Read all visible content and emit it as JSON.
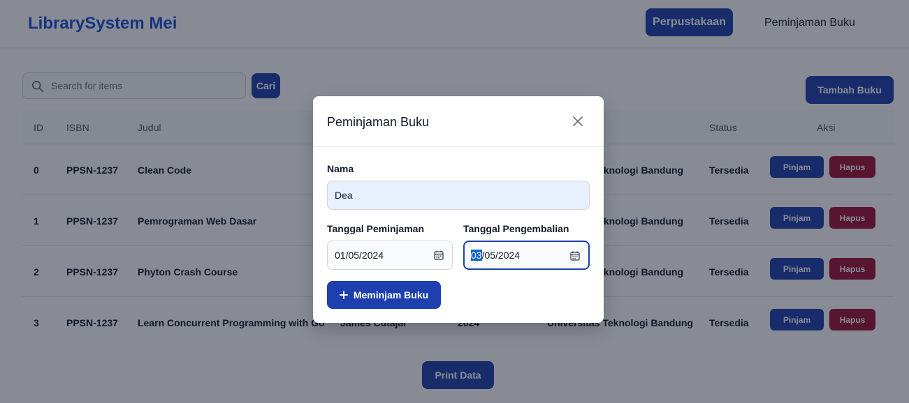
{
  "header": {
    "brand": "LibrarySystem Mei",
    "nav_active": "Perpustakaan",
    "nav_link": "Peminjaman Buku"
  },
  "search": {
    "placeholder": "Search for items",
    "button": "Cari"
  },
  "add_button": "Tambah Buku",
  "table": {
    "columns": [
      "ID",
      "ISBN",
      "Judul",
      "Status",
      "Aksi"
    ],
    "rows": [
      {
        "id": "0",
        "isbn": "PPSN-1237",
        "judul": "Clean Code",
        "penerbit": "eknologi Bandung",
        "status": "Tersedia"
      },
      {
        "id": "1",
        "isbn": "PPSN-1237",
        "judul": "Pemrograman Web Dasar",
        "penerbit": "eknologi Bandung",
        "status": "Tersedia"
      },
      {
        "id": "2",
        "isbn": "PPSN-1237",
        "judul": "Phyton Crash Course",
        "penerbit": "eknologi Bandung",
        "status": "Tersedia"
      },
      {
        "id": "3",
        "isbn": "PPSN-1237",
        "judul": "Learn Concurrent Programming with Go",
        "penulis": "James Cutajar",
        "tahun": "2024",
        "penerbit": "Universitas Teknologi Bandung",
        "status": "Tersedia"
      }
    ],
    "pinjam_label": "Pinjam",
    "hapus_label": "Hapus"
  },
  "print_button": "Print Data",
  "modal": {
    "title": "Peminjaman Buku",
    "nama_label": "Nama",
    "nama_value": "Dea",
    "tgl_pinjam_label": "Tanggal Peminjaman",
    "tgl_pinjam_value": "01/05/2024",
    "tgl_kembali_label": "Tanggal Pengembalian",
    "tgl_kembali_day": "03",
    "tgl_kembali_rest": "/05/2024",
    "submit": "Meminjam Buku"
  },
  "colors": {
    "primary": "#1e40af",
    "danger": "#9f1239",
    "brand": "#1d4ed8"
  }
}
